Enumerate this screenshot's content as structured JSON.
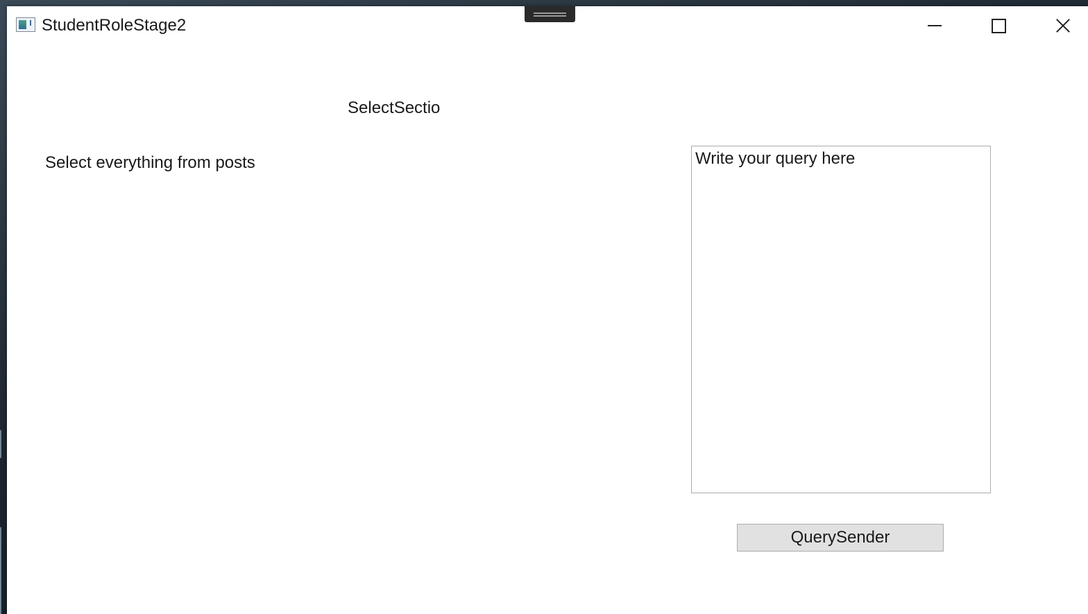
{
  "window": {
    "title": "StudentRoleStage2",
    "controls": {
      "minimize": "minimize",
      "maximize": "maximize",
      "close": "close"
    }
  },
  "content": {
    "section_label": "SelectSectio",
    "query_label": "Select everything from posts",
    "query_input": {
      "value": "Write your query here"
    },
    "send_button_label": "QuerySender"
  },
  "icons": {
    "app": "app-window-icon",
    "snap": "snap-layout-handle-icon",
    "minimize": "minimize-icon",
    "maximize": "maximize-icon",
    "close": "close-icon"
  },
  "colors": {
    "window_bg": "#ffffff",
    "button_bg": "#e1e1e1",
    "button_border": "#adadad",
    "textbox_border": "#acacac",
    "text": "#1a1a1a"
  }
}
